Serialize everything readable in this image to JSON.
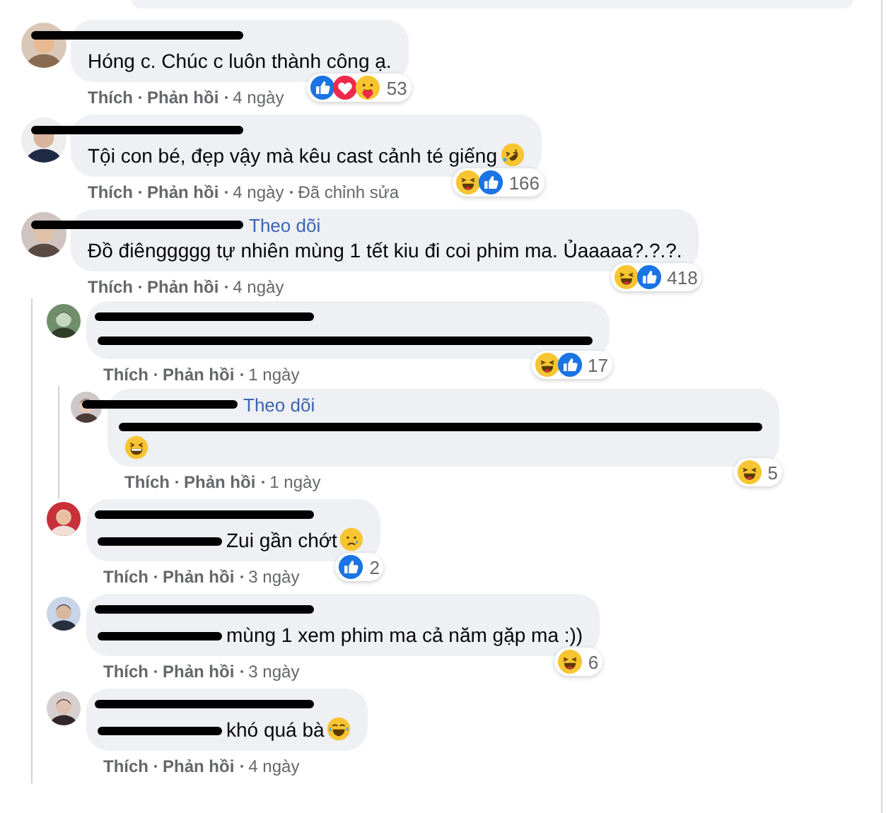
{
  "previous_comment_cut": true,
  "comments": [
    {
      "avatar": {
        "kind": "picture"
      },
      "name_redacted": true,
      "text": "Hóng c. Chúc c luôn thành công ạ.",
      "reactions": [
        {
          "kind": "like"
        },
        {
          "kind": "love"
        },
        {
          "kind": "care"
        }
      ],
      "reaction_count": "53",
      "meta": [
        {
          "kind": "action",
          "text": "Thích"
        },
        {
          "kind": "action",
          "text": "Phản hồi"
        },
        {
          "kind": "time",
          "text": "4 ngày"
        }
      ]
    },
    {
      "avatar": {
        "kind": "picture"
      },
      "name_redacted": true,
      "text": "Tội con bé, đẹp vậy mà kêu cast cảnh té giếng",
      "emoji": {
        "kind": "rofl"
      },
      "reactions": [
        {
          "kind": "haha"
        },
        {
          "kind": "like"
        }
      ],
      "reaction_count": "166",
      "meta": [
        {
          "kind": "action",
          "text": "Thích"
        },
        {
          "kind": "action",
          "text": "Phản hồi"
        },
        {
          "kind": "time",
          "text": "4 ngày"
        },
        {
          "kind": "note",
          "text": "Đã chỉnh sửa"
        }
      ]
    },
    {
      "avatar": {
        "kind": "picture"
      },
      "name_redacted": true,
      "follow": "Theo dõi",
      "text": "Đồ điênggggg tự nhiên mùng 1 tết kiu đi coi phim ma. Ủaaaaa?.?.?.",
      "reactions": [
        {
          "kind": "haha"
        },
        {
          "kind": "like"
        }
      ],
      "reaction_count": "418",
      "meta": [
        {
          "kind": "action",
          "text": "Thích"
        },
        {
          "kind": "action",
          "text": "Phản hồi"
        },
        {
          "kind": "time",
          "text": "4 ngày"
        }
      ],
      "replies": [
        {
          "avatar": {
            "kind": "picture"
          },
          "name_redacted": true,
          "text_redacted": true,
          "reactions": [
            {
              "kind": "haha"
            },
            {
              "kind": "like"
            }
          ],
          "reaction_count": "17",
          "meta": [
            {
              "kind": "action",
              "text": "Thích"
            },
            {
              "kind": "action",
              "text": "Phản hồi"
            },
            {
              "kind": "time",
              "text": "1 ngày"
            }
          ],
          "replies": [
            {
              "avatar": {
                "kind": "picture"
              },
              "name_redacted": true,
              "follow": "Theo dõi",
              "text_redacted": true,
              "emoji": {
                "kind": "grin"
              },
              "reactions": [
                {
                  "kind": "haha"
                }
              ],
              "reaction_count": "5",
              "meta": [
                {
                  "kind": "action",
                  "text": "Thích"
                },
                {
                  "kind": "action",
                  "text": "Phản hồi"
                },
                {
                  "kind": "time",
                  "text": "1 ngày"
                }
              ]
            }
          ]
        },
        {
          "avatar": {
            "kind": "picture"
          },
          "name_redacted": true,
          "mention_redacted": true,
          "text": "Zui gần chớt",
          "emoji": {
            "kind": "sad"
          },
          "reactions": [
            {
              "kind": "like"
            }
          ],
          "reaction_count": "2",
          "meta": [
            {
              "kind": "action",
              "text": "Thích"
            },
            {
              "kind": "action",
              "text": "Phản hồi"
            },
            {
              "kind": "time",
              "text": "3 ngày"
            }
          ]
        },
        {
          "avatar": {
            "kind": "picture"
          },
          "name_redacted": true,
          "mention_redacted": true,
          "text": "mùng 1 xem phim ma cả năm gặp ma :))",
          "reactions": [
            {
              "kind": "haha"
            }
          ],
          "reaction_count": "6",
          "meta": [
            {
              "kind": "action",
              "text": "Thích"
            },
            {
              "kind": "action",
              "text": "Phản hồi"
            },
            {
              "kind": "time",
              "text": "3 ngày"
            }
          ]
        },
        {
          "avatar": {
            "kind": "picture"
          },
          "name_redacted": true,
          "mention_redacted": true,
          "text": "khó quá bà",
          "emoji": {
            "kind": "tears"
          },
          "meta": [
            {
              "kind": "action",
              "text": "Thích"
            },
            {
              "kind": "action",
              "text": "Phản hồi"
            },
            {
              "kind": "time",
              "text": "4 ngày"
            }
          ]
        }
      ]
    }
  ]
}
